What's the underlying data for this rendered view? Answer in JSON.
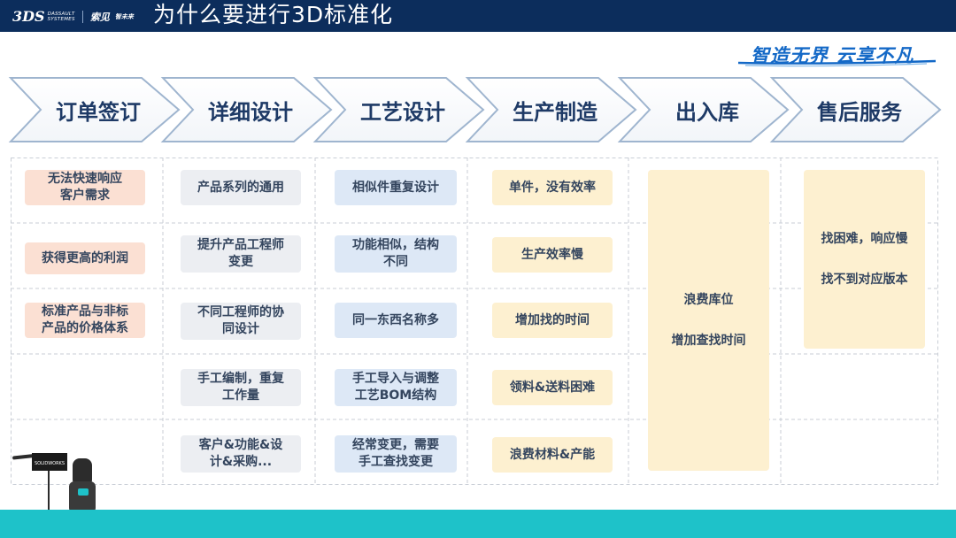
{
  "header": {
    "title": "为什么要进行3D标准化",
    "logo": {
      "mark": "3DS",
      "line1": "DASSAULT",
      "line2": "SYSTEMES",
      "cn1": "索见",
      "cn2": "智未来"
    }
  },
  "slogan": {
    "text": "智造无界 云享不凡"
  },
  "process_steps": [
    "订单签订",
    "详细设计",
    "工艺设计",
    "生产制造",
    "出入库",
    "售后服务"
  ],
  "columns": {
    "order": [
      "无法快速响应\n客户需求",
      "获得更高的利润",
      "标准产品与非标\n产品的价格体系"
    ],
    "design": [
      "产品系列的通用",
      "提升产品工程师\n变更",
      "不同工程师的协\n同设计",
      "手工编制，重复\n工作量",
      "客户&功能&设\n计&采购..."
    ],
    "process": [
      "相似件重复设计",
      "功能相似，结构\n不同",
      "同一东西名称多",
      "手工导入与调整\n工艺BOM结构",
      "经常变更，需要\n手工查找变更"
    ],
    "production": [
      "单件，没有效率",
      "生产效率慢",
      "增加找的时间",
      "领料&送料困难",
      "浪费材料&产能"
    ],
    "warehouse": [
      "浪费库位",
      "增加查找时间"
    ],
    "after_sales": [
      "找困难，响应慢",
      "找不到对应版本"
    ]
  },
  "colors": {
    "header": "#0c2d5c",
    "band": "#1ec2c9",
    "title_text": "#1e3a66",
    "slogan": "#1469c7"
  },
  "illustration": {
    "screen_label": "SOLIDWORKS"
  }
}
